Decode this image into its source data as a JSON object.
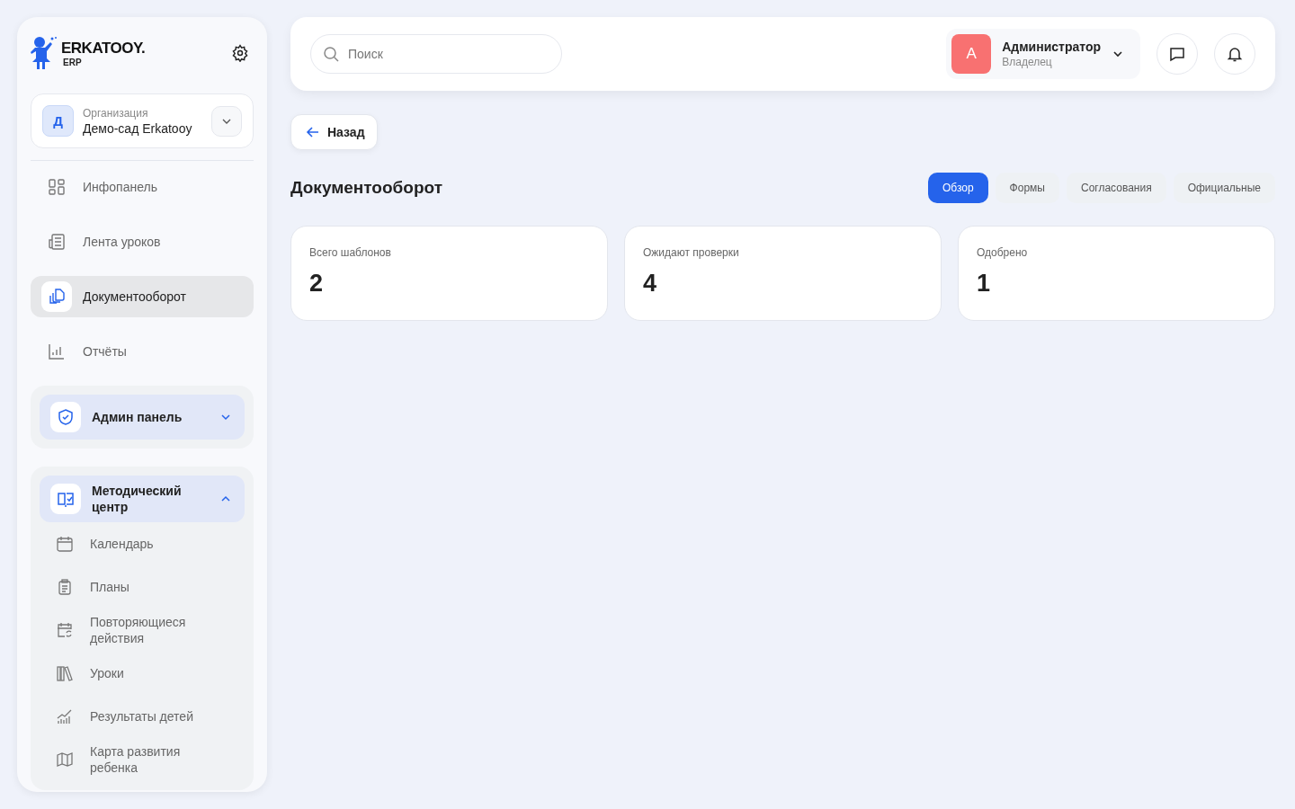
{
  "sidebar": {
    "logo": {
      "title": "ERKATOOY.",
      "subtitle": "ERP"
    },
    "organization": {
      "label": "Организация",
      "name": "Демо-сад Erkatooy",
      "initial": "Д"
    },
    "items": [
      {
        "label": "Инфопанель",
        "selected": false
      },
      {
        "label": "Лента уроков",
        "selected": false
      },
      {
        "label": "Документооборот",
        "selected": true
      },
      {
        "label": "Отчёты",
        "selected": false
      }
    ],
    "groups": [
      {
        "label": "Админ панель",
        "expanded": false
      },
      {
        "label": "Методический центр",
        "expanded": true,
        "children": [
          {
            "label": "Календарь"
          },
          {
            "label": "Планы"
          },
          {
            "label": "Повторяющиеся действия"
          },
          {
            "label": "Уроки"
          },
          {
            "label": "Результаты детей"
          },
          {
            "label": "Карта развития ребенка"
          }
        ]
      }
    ]
  },
  "header": {
    "search": {
      "placeholder": "Поиск"
    },
    "user": {
      "initial": "A",
      "name": "Администратор",
      "role": "Владелец"
    }
  },
  "back_button": "Назад",
  "title": "Документооборот",
  "tabs": [
    {
      "label": "Обзор",
      "selected": true
    },
    {
      "label": "Формы",
      "selected": false
    },
    {
      "label": "Согласования",
      "selected": false
    },
    {
      "label": "Официальные",
      "selected": false
    }
  ],
  "stats": [
    {
      "label": "Всего шаблонов",
      "value": "2"
    },
    {
      "label": "Ожидают проверки",
      "value": "4"
    },
    {
      "label": "Одобрено",
      "value": "1"
    }
  ]
}
